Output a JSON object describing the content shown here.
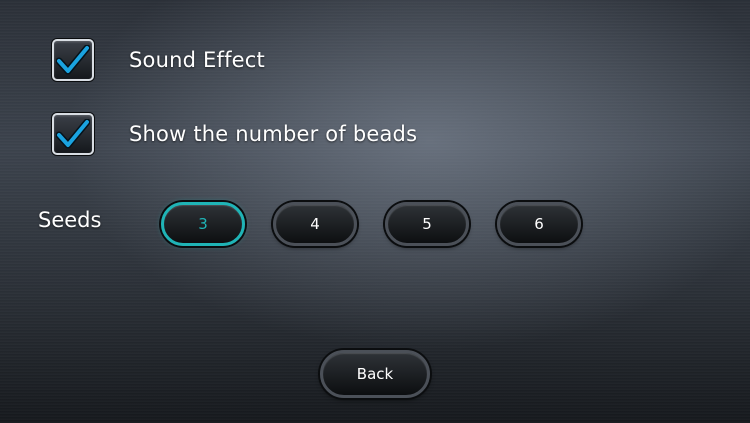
{
  "options": {
    "sound_effect": {
      "label": "Sound Effect",
      "checked": true
    },
    "show_beads": {
      "label": "Show the number of beads",
      "checked": true
    }
  },
  "seeds": {
    "label": "Seeds",
    "choices": [
      "3",
      "4",
      "5",
      "6"
    ],
    "selected": "3"
  },
  "back_label": "Back",
  "colors": {
    "check_mark": "#1aa3e0",
    "selected_accent": "#1fb4b6"
  },
  "icons": {
    "checkbox": "checkmark-icon"
  }
}
